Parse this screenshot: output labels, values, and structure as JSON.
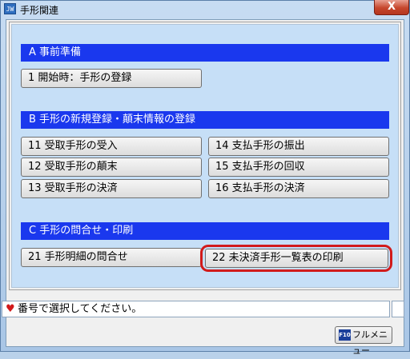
{
  "window": {
    "icon_text": "JW",
    "title": "手形関連",
    "close_label": "X"
  },
  "sections": [
    {
      "header": "A  事前準備"
    },
    {
      "header": "B  手形の新規登録・顛末情報の登録"
    },
    {
      "header": "C  手形の問合せ・印刷"
    }
  ],
  "buttons": {
    "b1": "1  開始時：手形の登録",
    "b11": "11  受取手形の受入",
    "b12": "12  受取手形の顛末",
    "b13": "13  受取手形の決済",
    "b14": "14  支払手形の振出",
    "b15": "15  支払手形の回収",
    "b16": "16  支払手形の決済",
    "b21": "21  手形明細の問合せ",
    "b22": "22  未決済手形一覧表の印刷"
  },
  "status": {
    "icon": "heart-icon",
    "icon_glyph": "♥",
    "text": "番号で選択してください。"
  },
  "footer": {
    "fkey": "F10",
    "fullmenu_label": "フルメニュー"
  },
  "colors": {
    "section_header": "#1a38ee",
    "highlight": "#d11b1b",
    "panel": "#c6dff7"
  }
}
